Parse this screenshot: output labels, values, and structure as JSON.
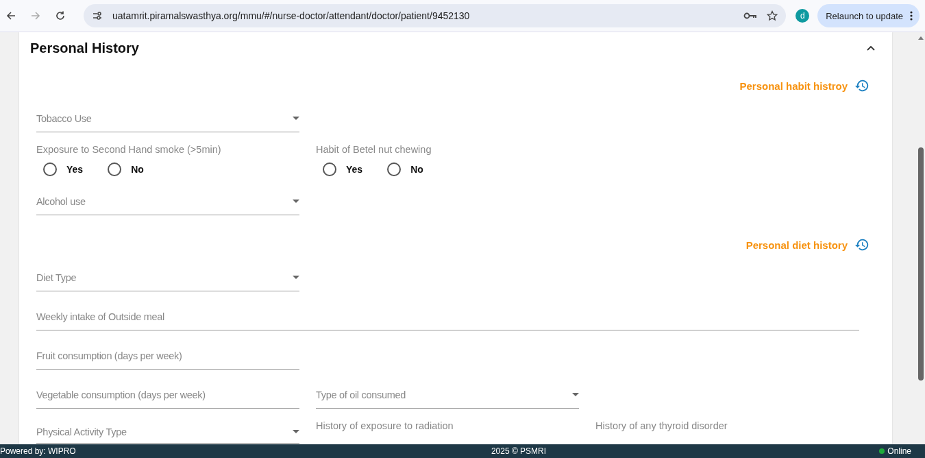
{
  "browser": {
    "url": "uatamrit.piramalswasthya.org/mmu/#/nurse-doctor/attendant/doctor/patient/9452130",
    "avatar": "d",
    "relaunch": "Relaunch to update"
  },
  "section": {
    "title": "Personal History",
    "expanded": true
  },
  "rows": [
    {
      "kind": "link",
      "label": "Personal habit histroy"
    },
    {
      "kind": "fields",
      "fields": [
        {
          "kind": "select",
          "label": "Tobacco Use"
        }
      ]
    },
    {
      "kind": "fields",
      "fields": [
        {
          "kind": "radio",
          "label": "Exposure to Second Hand smoke (>5min)",
          "options": [
            {
              "label": "Yes",
              "selected": false
            },
            {
              "label": "No",
              "selected": false
            }
          ]
        },
        {
          "kind": "radio",
          "label": "Habit of Betel nut chewing",
          "options": [
            {
              "label": "Yes",
              "selected": false
            },
            {
              "label": "No",
              "selected": false
            }
          ]
        }
      ]
    },
    {
      "kind": "fields",
      "fields": [
        {
          "kind": "select",
          "label": "Alcohol use"
        }
      ]
    },
    {
      "kind": "link",
      "label": "Personal diet history"
    },
    {
      "kind": "fields",
      "fields": [
        {
          "kind": "select",
          "label": "Diet Type"
        }
      ]
    },
    {
      "kind": "fields",
      "fields": [
        {
          "kind": "text",
          "label": "Weekly intake of Outside meal",
          "wide": true
        }
      ]
    },
    {
      "kind": "fields",
      "fields": [
        {
          "kind": "text",
          "label": "Fruit consumption (days per week)"
        }
      ]
    },
    {
      "kind": "fields",
      "fields": [
        {
          "kind": "text",
          "label": "Vegetable consumption (days per week)"
        },
        {
          "kind": "select",
          "label": "Type of oil consumed"
        }
      ]
    },
    {
      "kind": "fields",
      "fields": [
        {
          "kind": "select",
          "label": "Physical Activity Type"
        },
        {
          "kind": "radio",
          "label": "History of exposure to radiation"
        },
        {
          "kind": "radio",
          "label": "History of any thyroid disorder"
        }
      ]
    }
  ],
  "footer": {
    "left": "Powered by: WIPRO",
    "center": "2025 © PSMRI",
    "status": {
      "label": "Online",
      "online": true
    }
  }
}
